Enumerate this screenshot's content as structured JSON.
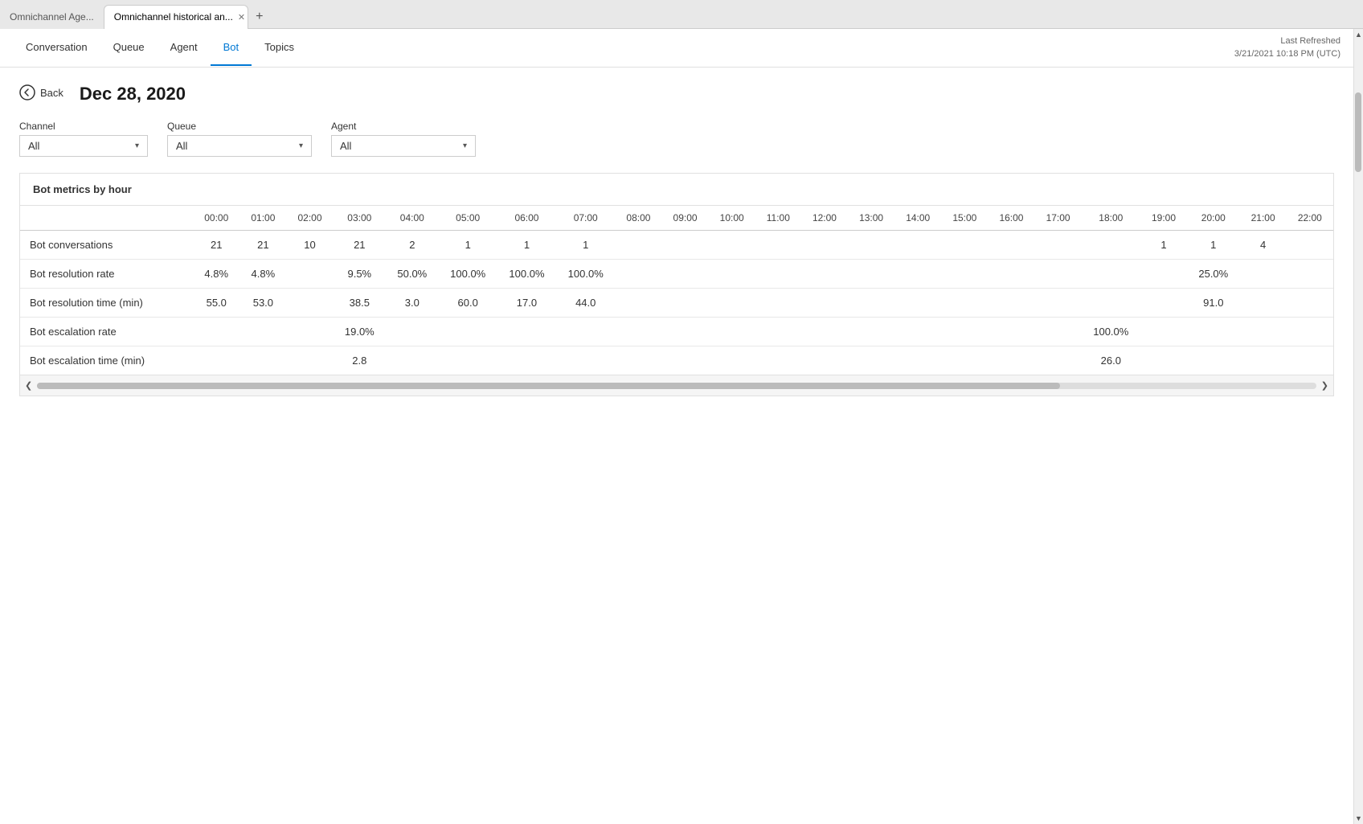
{
  "browser": {
    "tabs": [
      {
        "id": "tab1",
        "label": "Omnichannel Age...",
        "active": false
      },
      {
        "id": "tab2",
        "label": "Omnichannel historical an...",
        "active": true
      }
    ],
    "new_tab_label": "+"
  },
  "nav": {
    "tabs": [
      {
        "id": "conversation",
        "label": "Conversation",
        "active": false
      },
      {
        "id": "queue",
        "label": "Queue",
        "active": false
      },
      {
        "id": "agent",
        "label": "Agent",
        "active": false
      },
      {
        "id": "bot",
        "label": "Bot",
        "active": true
      },
      {
        "id": "topics",
        "label": "Topics",
        "active": false
      }
    ],
    "last_refreshed_label": "Last Refreshed",
    "last_refreshed_value": "3/21/2021 10:18 PM (UTC)"
  },
  "page": {
    "back_label": "Back",
    "date": "Dec 28, 2020"
  },
  "filters": {
    "channel": {
      "label": "Channel",
      "value": "All"
    },
    "queue": {
      "label": "Queue",
      "value": "All"
    },
    "agent": {
      "label": "Agent",
      "value": "All"
    }
  },
  "table": {
    "title": "Bot metrics by hour",
    "hours": [
      "00:00",
      "01:00",
      "02:00",
      "03:00",
      "04:00",
      "05:00",
      "06:00",
      "07:00",
      "08:00",
      "09:00",
      "10:00",
      "11:00",
      "12:00",
      "13:00",
      "14:00",
      "15:00",
      "16:00",
      "17:00",
      "18:00",
      "19:00",
      "20:00",
      "21:00",
      "22:00"
    ],
    "rows": [
      {
        "label": "Bot conversations",
        "values": {
          "00:00": "21",
          "01:00": "21",
          "02:00": "10",
          "03:00": "21",
          "04:00": "2",
          "05:00": "1",
          "06:00": "1",
          "07:00": "1",
          "08:00": "",
          "09:00": "",
          "10:00": "",
          "11:00": "",
          "12:00": "",
          "13:00": "",
          "14:00": "",
          "15:00": "",
          "16:00": "",
          "17:00": "",
          "18:00": "",
          "19:00": "1",
          "20:00": "1",
          "21:00": "4",
          "22:00": ""
        }
      },
      {
        "label": "Bot resolution rate",
        "values": {
          "00:00": "4.8%",
          "01:00": "4.8%",
          "02:00": "",
          "03:00": "9.5%",
          "04:00": "50.0%",
          "05:00": "100.0%",
          "06:00": "100.0%",
          "07:00": "100.0%",
          "08:00": "",
          "09:00": "",
          "10:00": "",
          "11:00": "",
          "12:00": "",
          "13:00": "",
          "14:00": "",
          "15:00": "",
          "16:00": "",
          "17:00": "",
          "18:00": "",
          "19:00": "",
          "20:00": "25.0%",
          "21:00": "",
          "22:00": ""
        }
      },
      {
        "label": "Bot resolution time (min)",
        "values": {
          "00:00": "55.0",
          "01:00": "53.0",
          "02:00": "",
          "03:00": "38.5",
          "04:00": "3.0",
          "05:00": "60.0",
          "06:00": "17.0",
          "07:00": "44.0",
          "08:00": "",
          "09:00": "",
          "10:00": "",
          "11:00": "",
          "12:00": "",
          "13:00": "",
          "14:00": "",
          "15:00": "",
          "16:00": "",
          "17:00": "",
          "18:00": "",
          "19:00": "",
          "20:00": "91.0",
          "21:00": "",
          "22:00": ""
        }
      },
      {
        "label": "Bot escalation rate",
        "values": {
          "00:00": "",
          "01:00": "",
          "02:00": "",
          "03:00": "19.0%",
          "04:00": "",
          "05:00": "",
          "06:00": "",
          "07:00": "",
          "08:00": "",
          "09:00": "",
          "10:00": "",
          "11:00": "",
          "12:00": "",
          "13:00": "",
          "14:00": "",
          "15:00": "",
          "16:00": "",
          "17:00": "",
          "18:00": "100.0%",
          "19:00": "",
          "20:00": "",
          "21:00": "",
          "22:00": ""
        }
      },
      {
        "label": "Bot escalation time (min)",
        "values": {
          "00:00": "",
          "01:00": "",
          "02:00": "",
          "03:00": "2.8",
          "04:00": "",
          "05:00": "",
          "06:00": "",
          "07:00": "",
          "08:00": "",
          "09:00": "",
          "10:00": "",
          "11:00": "",
          "12:00": "",
          "13:00": "",
          "14:00": "",
          "15:00": "",
          "16:00": "",
          "17:00": "",
          "18:00": "26.0",
          "19:00": "",
          "20:00": "",
          "21:00": "",
          "22:00": ""
        }
      }
    ]
  }
}
